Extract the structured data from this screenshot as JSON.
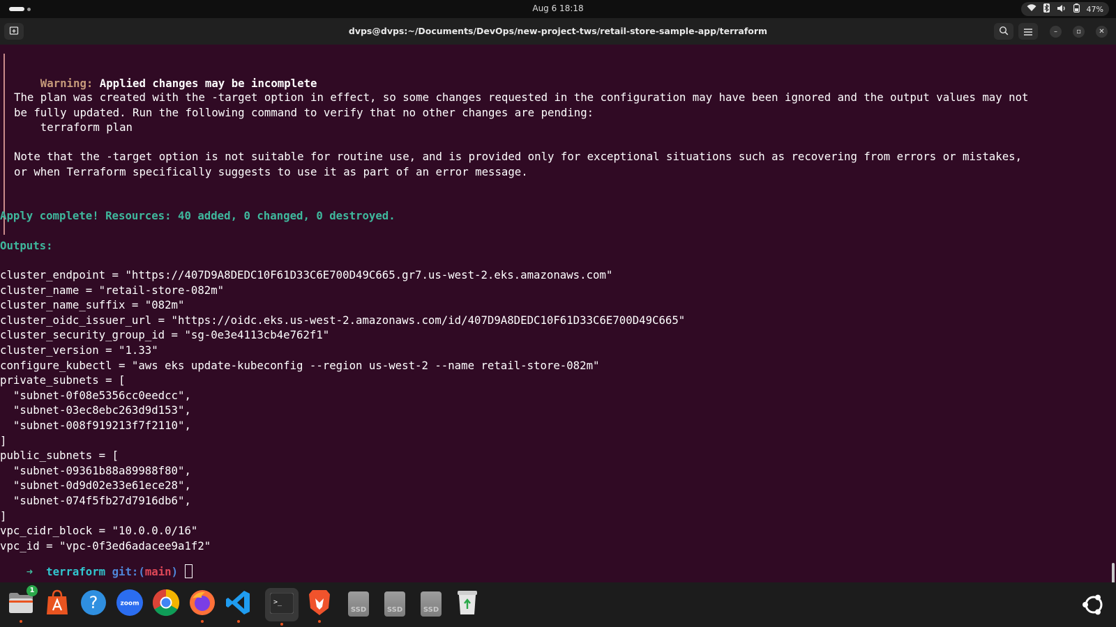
{
  "topbar": {
    "clock": "Aug 6  18:18",
    "battery": "47%"
  },
  "window": {
    "title": "dvps@dvps:~/Documents/DevOps/new-project-tws/retail-store-sample-app/terraform"
  },
  "terminal": {
    "warning_label": "Warning:",
    "warning_title": "Applied changes may be incomplete",
    "warning_lines": [
      "The plan was created with the -target option in effect, so some changes requested in the configuration may have been ignored and the output values may not",
      "be fully updated. Run the following command to verify that no other changes are pending:",
      "    terraform plan",
      "Note that the -target option is not suitable for routine use, and is provided only for exceptional situations such as recovering from errors or mistakes,",
      "or when Terraform specifically suggests to use it as part of an error message."
    ],
    "apply_complete": "Apply complete! Resources: 40 added, 0 changed, 0 destroyed.",
    "outputs_header": "Outputs:",
    "output_lines": [
      "cluster_endpoint = \"https://407D9A8DEDC10F61D33C6E700D49C665.gr7.us-west-2.eks.amazonaws.com\"",
      "cluster_name = \"retail-store-082m\"",
      "cluster_name_suffix = \"082m\"",
      "cluster_oidc_issuer_url = \"https://oidc.eks.us-west-2.amazonaws.com/id/407D9A8DEDC10F61D33C6E700D49C665\"",
      "cluster_security_group_id = \"sg-0e3e4113cb4e762f1\"",
      "cluster_version = \"1.33\"",
      "configure_kubectl = \"aws eks update-kubeconfig --region us-west-2 --name retail-store-082m\"",
      "private_subnets = [",
      "  \"subnet-0f08e5356cc0eedcc\",",
      "  \"subnet-03ec8ebc263d9d153\",",
      "  \"subnet-008f919213f7f2110\",",
      "]",
      "public_subnets = [",
      "  \"subnet-09361b88a89988f80\",",
      "  \"subnet-0d9d02e33e61ece28\",",
      "  \"subnet-074f5fb27d7916db6\",",
      "]",
      "vpc_cidr_block = \"10.0.0.0/16\"",
      "vpc_id = \"vpc-0f3ed6adacee9a1f2\""
    ],
    "prompt": {
      "arrow": "➜",
      "directory": "terraform",
      "git_prefix": "git:(",
      "branch": "main",
      "git_suffix": ")"
    }
  },
  "dock": {
    "apps": [
      {
        "name": "Files",
        "icon": "files-icon",
        "badge": "1"
      },
      {
        "name": "App Center",
        "icon": "app-center-icon"
      },
      {
        "name": "Help",
        "icon": "help-icon"
      },
      {
        "name": "Zoom",
        "icon": "zoom-icon",
        "label": "zoom"
      },
      {
        "name": "Google Chrome",
        "icon": "chrome-icon"
      },
      {
        "name": "Firefox",
        "icon": "firefox-icon"
      },
      {
        "name": "Visual Studio Code",
        "icon": "vscode-icon"
      },
      {
        "name": "Terminal",
        "icon": "terminal-icon",
        "label": ">_"
      },
      {
        "name": "Brave",
        "icon": "brave-icon"
      },
      {
        "name": "SSD",
        "icon": "ssd-drive-icon",
        "label": "SSD"
      },
      {
        "name": "SSD",
        "icon": "ssd-drive-icon",
        "label": "SSD"
      },
      {
        "name": "SSD",
        "icon": "ssd-drive-icon",
        "label": "SSD"
      },
      {
        "name": "Trash",
        "icon": "trash-icon"
      }
    ]
  },
  "colors": {
    "terminal_bg": "#300a24",
    "success_green": "#3fb89d",
    "warning_label": "#c69a7a",
    "branch_red": "#e04858",
    "accent_orange": "#e95420"
  }
}
